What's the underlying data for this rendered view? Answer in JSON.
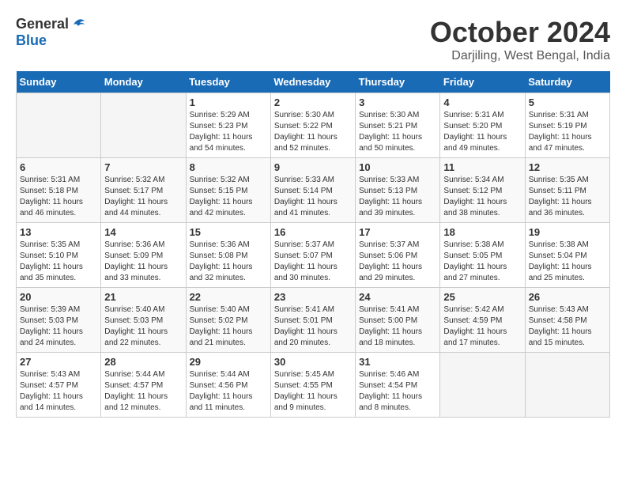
{
  "header": {
    "logo_line1": "General",
    "logo_line2": "Blue",
    "month_year": "October 2024",
    "location": "Darjiling, West Bengal, India"
  },
  "days_of_week": [
    "Sunday",
    "Monday",
    "Tuesday",
    "Wednesday",
    "Thursday",
    "Friday",
    "Saturday"
  ],
  "weeks": [
    [
      {
        "day": "",
        "empty": true
      },
      {
        "day": "",
        "empty": true
      },
      {
        "day": "1",
        "sunrise": "5:29 AM",
        "sunset": "5:23 PM",
        "daylight": "11 hours and 54 minutes."
      },
      {
        "day": "2",
        "sunrise": "5:30 AM",
        "sunset": "5:22 PM",
        "daylight": "11 hours and 52 minutes."
      },
      {
        "day": "3",
        "sunrise": "5:30 AM",
        "sunset": "5:21 PM",
        "daylight": "11 hours and 50 minutes."
      },
      {
        "day": "4",
        "sunrise": "5:31 AM",
        "sunset": "5:20 PM",
        "daylight": "11 hours and 49 minutes."
      },
      {
        "day": "5",
        "sunrise": "5:31 AM",
        "sunset": "5:19 PM",
        "daylight": "11 hours and 47 minutes."
      }
    ],
    [
      {
        "day": "6",
        "sunrise": "5:31 AM",
        "sunset": "5:18 PM",
        "daylight": "11 hours and 46 minutes."
      },
      {
        "day": "7",
        "sunrise": "5:32 AM",
        "sunset": "5:17 PM",
        "daylight": "11 hours and 44 minutes."
      },
      {
        "day": "8",
        "sunrise": "5:32 AM",
        "sunset": "5:15 PM",
        "daylight": "11 hours and 42 minutes."
      },
      {
        "day": "9",
        "sunrise": "5:33 AM",
        "sunset": "5:14 PM",
        "daylight": "11 hours and 41 minutes."
      },
      {
        "day": "10",
        "sunrise": "5:33 AM",
        "sunset": "5:13 PM",
        "daylight": "11 hours and 39 minutes."
      },
      {
        "day": "11",
        "sunrise": "5:34 AM",
        "sunset": "5:12 PM",
        "daylight": "11 hours and 38 minutes."
      },
      {
        "day": "12",
        "sunrise": "5:35 AM",
        "sunset": "5:11 PM",
        "daylight": "11 hours and 36 minutes."
      }
    ],
    [
      {
        "day": "13",
        "sunrise": "5:35 AM",
        "sunset": "5:10 PM",
        "daylight": "11 hours and 35 minutes."
      },
      {
        "day": "14",
        "sunrise": "5:36 AM",
        "sunset": "5:09 PM",
        "daylight": "11 hours and 33 minutes."
      },
      {
        "day": "15",
        "sunrise": "5:36 AM",
        "sunset": "5:08 PM",
        "daylight": "11 hours and 32 minutes."
      },
      {
        "day": "16",
        "sunrise": "5:37 AM",
        "sunset": "5:07 PM",
        "daylight": "11 hours and 30 minutes."
      },
      {
        "day": "17",
        "sunrise": "5:37 AM",
        "sunset": "5:06 PM",
        "daylight": "11 hours and 29 minutes."
      },
      {
        "day": "18",
        "sunrise": "5:38 AM",
        "sunset": "5:05 PM",
        "daylight": "11 hours and 27 minutes."
      },
      {
        "day": "19",
        "sunrise": "5:38 AM",
        "sunset": "5:04 PM",
        "daylight": "11 hours and 25 minutes."
      }
    ],
    [
      {
        "day": "20",
        "sunrise": "5:39 AM",
        "sunset": "5:03 PM",
        "daylight": "11 hours and 24 minutes."
      },
      {
        "day": "21",
        "sunrise": "5:40 AM",
        "sunset": "5:03 PM",
        "daylight": "11 hours and 22 minutes."
      },
      {
        "day": "22",
        "sunrise": "5:40 AM",
        "sunset": "5:02 PM",
        "daylight": "11 hours and 21 minutes."
      },
      {
        "day": "23",
        "sunrise": "5:41 AM",
        "sunset": "5:01 PM",
        "daylight": "11 hours and 20 minutes."
      },
      {
        "day": "24",
        "sunrise": "5:41 AM",
        "sunset": "5:00 PM",
        "daylight": "11 hours and 18 minutes."
      },
      {
        "day": "25",
        "sunrise": "5:42 AM",
        "sunset": "4:59 PM",
        "daylight": "11 hours and 17 minutes."
      },
      {
        "day": "26",
        "sunrise": "5:43 AM",
        "sunset": "4:58 PM",
        "daylight": "11 hours and 15 minutes."
      }
    ],
    [
      {
        "day": "27",
        "sunrise": "5:43 AM",
        "sunset": "4:57 PM",
        "daylight": "11 hours and 14 minutes."
      },
      {
        "day": "28",
        "sunrise": "5:44 AM",
        "sunset": "4:57 PM",
        "daylight": "11 hours and 12 minutes."
      },
      {
        "day": "29",
        "sunrise": "5:44 AM",
        "sunset": "4:56 PM",
        "daylight": "11 hours and 11 minutes."
      },
      {
        "day": "30",
        "sunrise": "5:45 AM",
        "sunset": "4:55 PM",
        "daylight": "11 hours and 9 minutes."
      },
      {
        "day": "31",
        "sunrise": "5:46 AM",
        "sunset": "4:54 PM",
        "daylight": "11 hours and 8 minutes."
      },
      {
        "day": "",
        "empty": true
      },
      {
        "day": "",
        "empty": true
      }
    ]
  ],
  "labels": {
    "sunrise": "Sunrise:",
    "sunset": "Sunset:",
    "daylight": "Daylight: "
  }
}
